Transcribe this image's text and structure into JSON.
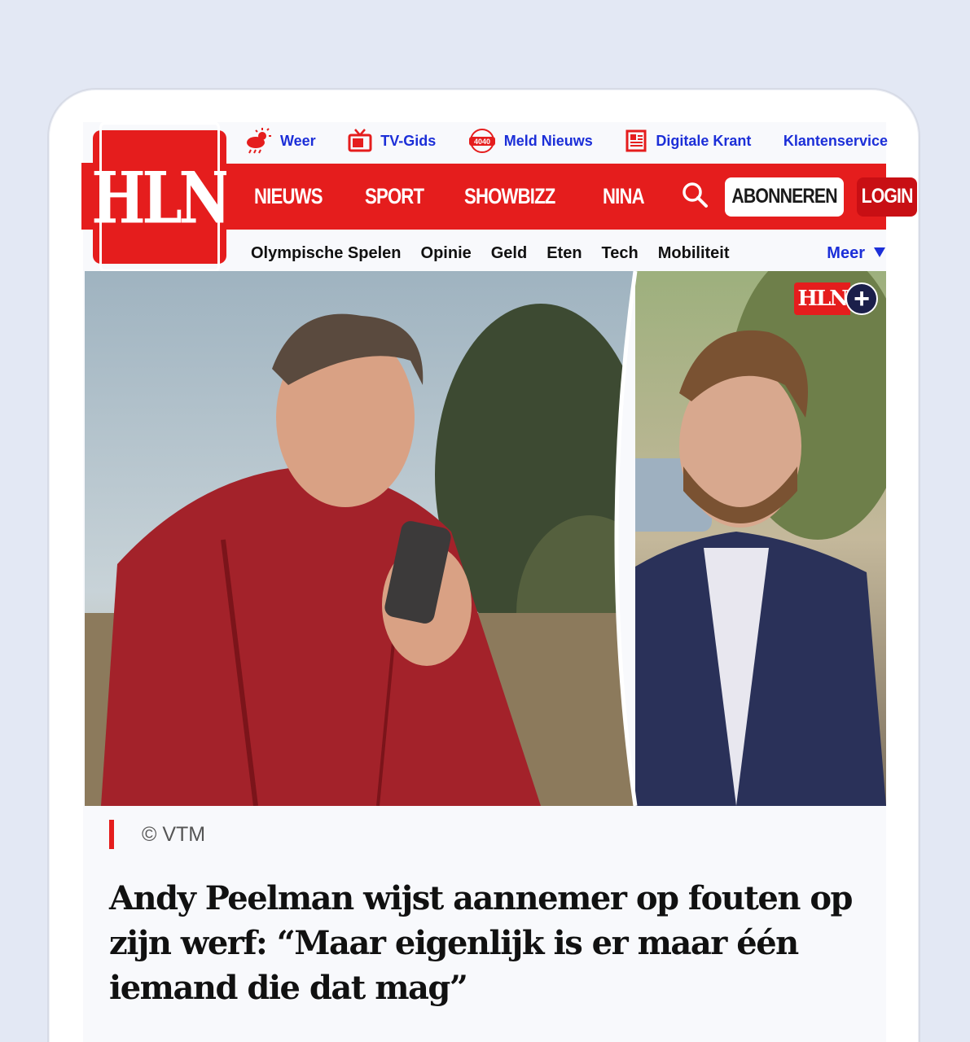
{
  "utility": {
    "items": [
      {
        "label": "Weer",
        "icon": "weather-icon"
      },
      {
        "label": "TV-Gids",
        "icon": "tv-icon"
      },
      {
        "label": "Meld Nieuws",
        "icon": "4040-icon"
      },
      {
        "label": "Digitale Krant",
        "icon": "newspaper-icon"
      },
      {
        "label": "Klantenservice",
        "icon": ""
      }
    ],
    "meld_badge": "4040"
  },
  "logo": {
    "text": "HLN"
  },
  "main_nav": {
    "items": [
      "NIEUWS",
      "SPORT",
      "SHOWBIZZ",
      "NINA"
    ],
    "subscribe_label": "ABONNEREN",
    "login_label": "LOGIN"
  },
  "sub_nav": {
    "items": [
      "Olympische Spelen",
      "Opinie",
      "Geld",
      "Eten",
      "Tech",
      "Mobiliteit"
    ],
    "more_label": "Meer"
  },
  "article": {
    "badge_text": "HLN",
    "caption": "© VTM",
    "headline": "Andy Peelman wijst aannemer op fouten op zijn werf: “Maar eigenlijk is er maar één iemand die dat mag”"
  },
  "colors": {
    "brand_red": "#e51d1d",
    "link_blue": "#1c2fd8",
    "background": "#e3e8f4"
  }
}
